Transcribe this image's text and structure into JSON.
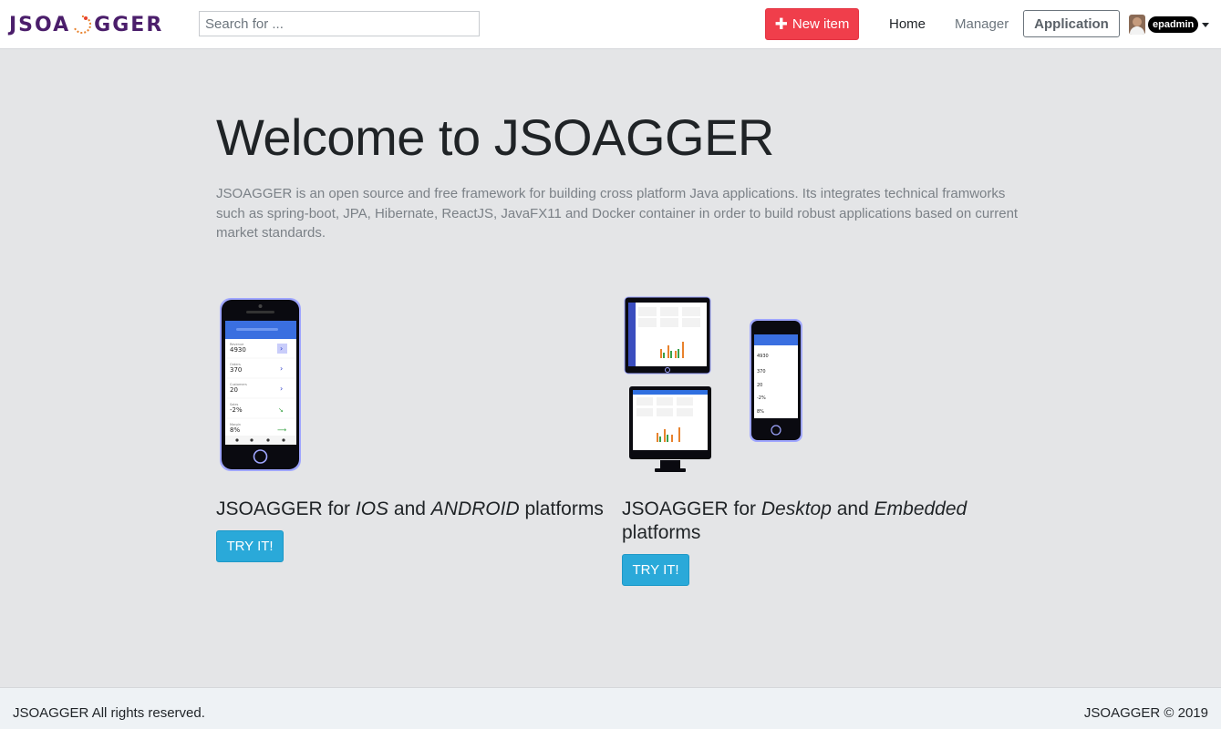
{
  "navbar": {
    "brand_left": "JSOA",
    "brand_right": "GGER",
    "search_placeholder": "Search for ...",
    "new_item_label": "New item",
    "home_label": "Home",
    "manager_label": "Manager",
    "application_label": "Application",
    "user_name": "epadmin"
  },
  "main": {
    "title": "Welcome to JSOAGGER",
    "lead": "JSOAGGER is an open source and free framework for building cross platform Java applications. Its integrates technical framworks such as spring-boot, JPA, Hibernate, ReactJS, JavaFX11 and Docker container in order to build robust applications based on current market standards.",
    "cards": [
      {
        "heading_prefix": "JSOAGGER for ",
        "heading_em1": "IOS",
        "heading_mid": " and ",
        "heading_em2": "ANDROID",
        "heading_suffix": " platforms",
        "button_label": "TRY IT!"
      },
      {
        "heading_prefix": "JSOAGGER for ",
        "heading_em1": "Desktop",
        "heading_mid": " and ",
        "heading_em2": "Embedded",
        "heading_suffix": " platforms",
        "button_label": "TRY IT!"
      }
    ],
    "phone_screen": {
      "rows": [
        {
          "label": "Revenue",
          "value": "4930"
        },
        {
          "label": "Orders",
          "value": "370"
        },
        {
          "label": "Customers",
          "value": "20"
        },
        {
          "label": "Sales",
          "value": "-2%"
        },
        {
          "label": "Margin",
          "value": "8%"
        }
      ]
    }
  },
  "footer": {
    "left": "JSOAGGER All rights reserved.",
    "right": "JSOAGGER © 2019"
  },
  "colors": {
    "brand": "#4b1e6b",
    "danger": "#f03e4b",
    "info": "#2aa9d9",
    "screen_header": "#2f6fe0"
  }
}
